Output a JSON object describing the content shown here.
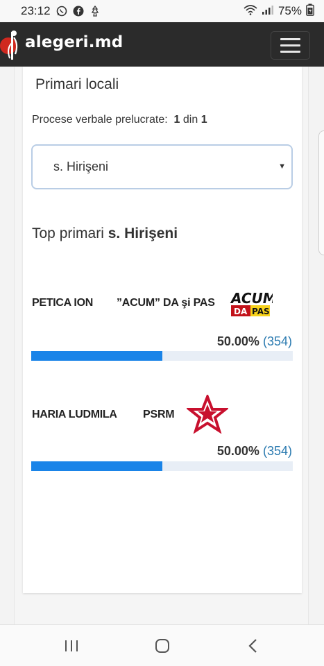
{
  "status_bar": {
    "time": "23:12",
    "battery": "75%",
    "icons": [
      "whatsapp-icon",
      "facebook-icon",
      "notification-icon",
      "wifi-icon",
      "signal-icon",
      "battery-icon"
    ]
  },
  "navbar": {
    "brand": "alegeri.md"
  },
  "main": {
    "section_title": "Primari locali",
    "processed_label": "Procese verbale prelucrate:",
    "processed_done": "1",
    "processed_of": "din",
    "processed_total": "1",
    "select_value": "s. Hirişeni",
    "top_prefix": "Top primari",
    "top_locality": "s. Hirişeni",
    "candidates": [
      {
        "name": "PETICA ION",
        "party": "”ACUM” DA şi PAS",
        "percent": "50.00%",
        "votes": "(354)",
        "share": 0.5,
        "logo": "acum-da-pas-logo"
      },
      {
        "name": "HARIA LUDMILA",
        "party": "PSRM",
        "percent": "50.00%",
        "votes": "(354)",
        "share": 0.5,
        "logo": "psrm-star-logo"
      }
    ]
  },
  "bottom_nav": {
    "icons": [
      "recent-apps-icon",
      "home-icon",
      "back-icon"
    ]
  },
  "colors": {
    "navbar_bg": "#2b2b2b",
    "bar_fill": "#1a84e8",
    "bar_track": "#e8eef6",
    "votes_link": "#2a7ab0"
  }
}
